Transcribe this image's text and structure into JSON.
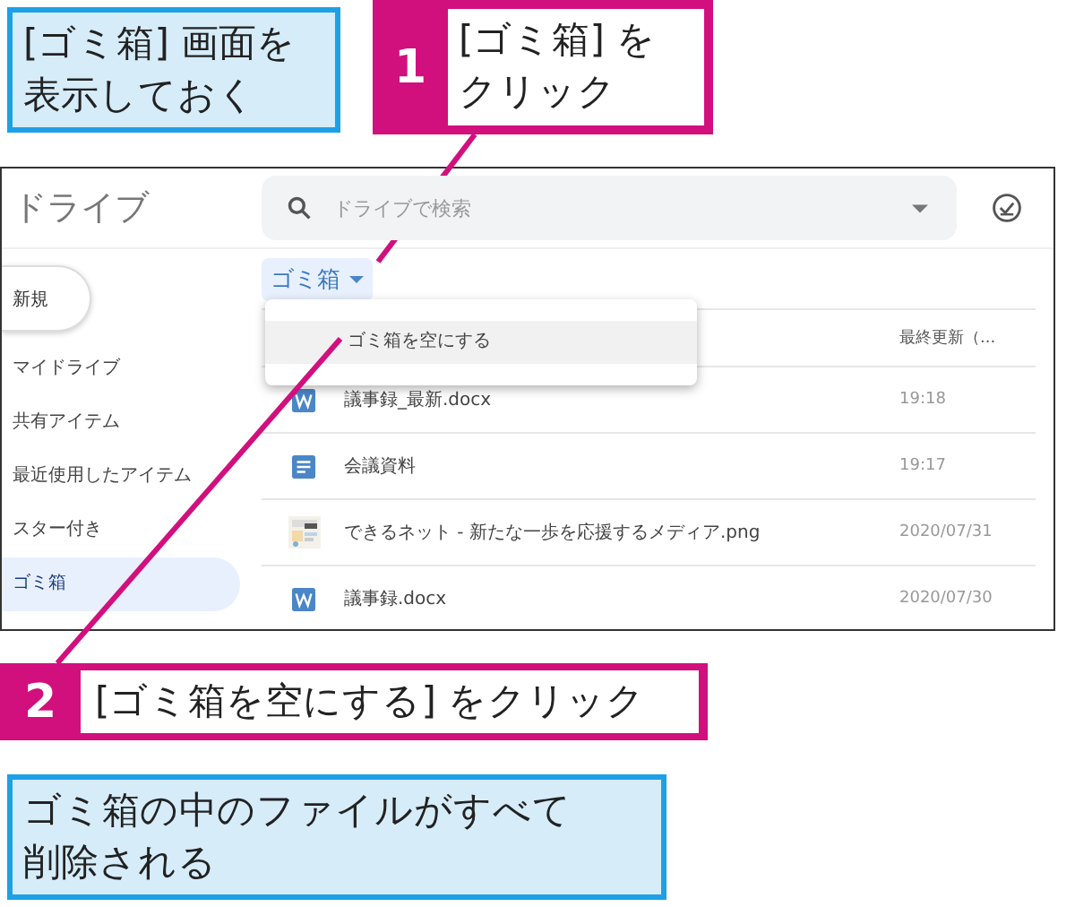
{
  "callout_top": {
    "lines": [
      "[ゴミ箱] 画面を",
      "表示しておく"
    ]
  },
  "step_1": {
    "number": "1",
    "lines": [
      "[ゴミ箱] を",
      "クリック"
    ]
  },
  "drive": {
    "logo": "ドライブ",
    "search": {
      "placeholder": "ドライブで検索"
    },
    "new_button": "新規",
    "sidebar": [
      {
        "label": "マイドライブ",
        "selected": false
      },
      {
        "label": "共有アイテム",
        "selected": false
      },
      {
        "label": "最近使用したアイテム",
        "selected": false
      },
      {
        "label": "スター付き",
        "selected": false
      },
      {
        "label": "ゴミ箱",
        "selected": true
      }
    ],
    "breadcrumb": "ゴミ箱",
    "menu": [
      "ゴミ箱を空にする"
    ],
    "column_header": "最終更新（...",
    "files": [
      {
        "kind": "word",
        "name": "議事録_最新.docx",
        "modified": "19:18"
      },
      {
        "kind": "doc",
        "name": "会議資料",
        "modified": "19:17"
      },
      {
        "kind": "picture",
        "name": "できるネット - 新たな一歩を応援するメディア.png",
        "modified": "2020/07/31"
      },
      {
        "kind": "word",
        "name": "議事録.docx",
        "modified": "2020/07/30"
      }
    ]
  },
  "step_2": {
    "number": "2",
    "text": "[ゴミ箱を空にする] をクリック"
  },
  "callout_result": {
    "lines": [
      "ゴミ箱の中のファイルがすべて",
      "削除される"
    ]
  }
}
